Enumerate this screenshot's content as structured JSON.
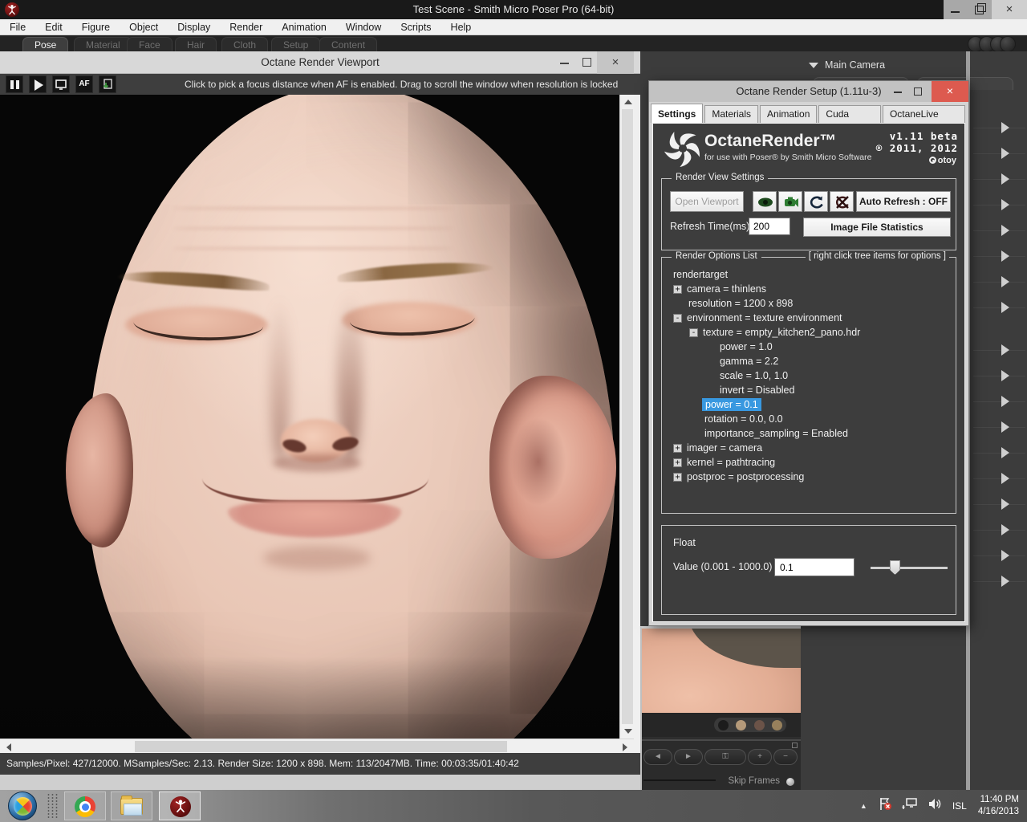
{
  "window": {
    "title": "Test Scene - Smith Micro Poser Pro  (64-bit)"
  },
  "menu": {
    "items": [
      "File",
      "Edit",
      "Figure",
      "Object",
      "Display",
      "Render",
      "Animation",
      "Window",
      "Scripts",
      "Help"
    ]
  },
  "rooms": {
    "items": [
      "Pose",
      "Material",
      "Face",
      "Hair",
      "Cloth",
      "Setup",
      "Content"
    ],
    "active": "Pose"
  },
  "viewport": {
    "title": "Octane Render Viewport",
    "af_label": "AF",
    "hint": "Click to pick a focus distance when AF is enabled.  Drag to scroll the window when resolution is locked",
    "status": "Samples/Pixel: 427/12000. MSamples/Sec: 2.13. Render Size: 1200 x 898. Mem: 113/2047MB. Time: 00:03:35/01:40:42"
  },
  "dialog": {
    "title": "Octane Render Setup (1.11u-3)",
    "close_glyph": "×",
    "tabs": [
      "Settings",
      "Materials",
      "Animation",
      "Cuda Devices",
      "OctaneLive Account"
    ],
    "active_tab": "Settings",
    "banner": {
      "brand": "OctaneRender™",
      "subtitle": "for use with Poser®  by Smith Micro Software",
      "version": "v1.11 beta",
      "copyright": "® 2011, 2012",
      "otoy": "otoy"
    },
    "render_view_settings": {
      "group_label": "Render  View Settings",
      "open_viewport": "Open Viewport",
      "auto_refresh": "Auto Refresh : OFF",
      "refresh_time_label": "Refresh Time(ms)",
      "refresh_time_value": "200",
      "image_file_statistics": "Image File Statistics"
    },
    "options_list": {
      "group_label": "Render Options List",
      "hint": "[ right click tree items for options ]",
      "tree": [
        {
          "label": "rendertarget",
          "expander": ""
        },
        {
          "label": "camera = thinlens",
          "expander": "+"
        },
        {
          "label": "resolution = 1200 x 898",
          "expander": ""
        },
        {
          "label": "environment = texture environment",
          "expander": "-"
        },
        {
          "label": "texture = empty_kitchen2_pano.hdr",
          "expander": "-"
        },
        {
          "label": "power = 1.0",
          "expander": ""
        },
        {
          "label": "gamma = 2.2",
          "expander": ""
        },
        {
          "label": "scale = 1.0, 1.0",
          "expander": ""
        },
        {
          "label": "invert = Disabled",
          "expander": ""
        },
        {
          "label": "power = 0.1",
          "expander": "",
          "selected": true
        },
        {
          "label": "rotation = 0.0, 0.0",
          "expander": ""
        },
        {
          "label": "importance_sampling = Enabled",
          "expander": ""
        },
        {
          "label": "imager = camera",
          "expander": "+"
        },
        {
          "label": "kernel = pathtracing",
          "expander": "+"
        },
        {
          "label": "postproc = postprocessing",
          "expander": "+"
        }
      ]
    },
    "float_editor": {
      "group_label": "Float",
      "value_label": "Value (0.001 - 1000.0)",
      "value": "0.1"
    }
  },
  "right_panel": {
    "camera_label": "Main Camera"
  },
  "preview": {
    "skip_frames": "Skip Frames"
  },
  "taskbar": {
    "language": "ISL",
    "time": "11:40 PM",
    "date": "4/16/2013"
  }
}
